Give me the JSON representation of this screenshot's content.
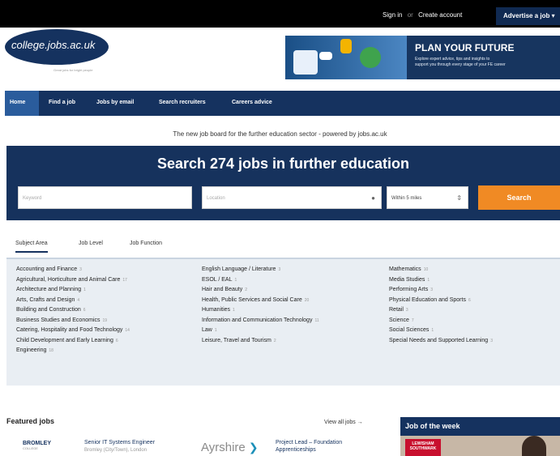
{
  "top": {
    "sign_in": "Sign in",
    "or": "or",
    "create_account": "Create account",
    "advertise": "Advertise a job"
  },
  "logo": {
    "text": "college.jobs.ac.uk",
    "tagline": "Great jobs for bright people"
  },
  "banner": {
    "title": "PLAN YOUR FUTURE",
    "sub1": "Explore expert advice, tips and insights to",
    "sub2": "support you through every stage of your FE career"
  },
  "nav": [
    "Home",
    "Find a job",
    "Jobs by email",
    "Search recruiters",
    "Careers advice"
  ],
  "tagline": "The new job board for the further education sector - powered by jobs.ac.uk",
  "search": {
    "title": "Search 274 jobs in further education",
    "keyword_placeholder": "Keyword",
    "location_placeholder": "Location",
    "distance": "Within 5 miles",
    "button": "Search"
  },
  "tabs": [
    "Subject Area",
    "Job Level",
    "Job Function"
  ],
  "categories": {
    "col1": [
      {
        "name": "Accounting and Finance",
        "count": "3"
      },
      {
        "name": "Agricultural, Horticulture and Animal Care",
        "count": "17"
      },
      {
        "name": "Architecture and Planning",
        "count": "1"
      },
      {
        "name": "Arts, Crafts and Design",
        "count": "4"
      },
      {
        "name": "Building and Construction",
        "count": "6"
      },
      {
        "name": "Business Studies and Economics",
        "count": "19"
      },
      {
        "name": "Catering, Hospitality and Food Technology",
        "count": "14"
      },
      {
        "name": "Child Development and Early Learning",
        "count": "6"
      },
      {
        "name": "Engineering",
        "count": "18"
      }
    ],
    "col2": [
      {
        "name": "English Language / Literature",
        "count": "3"
      },
      {
        "name": "ESOL / EAL",
        "count": "1"
      },
      {
        "name": "Hair and Beauty",
        "count": "2"
      },
      {
        "name": "Health, Public Services and Social Care",
        "count": "20"
      },
      {
        "name": "Humanities",
        "count": "1"
      },
      {
        "name": "Information and Communication Technology",
        "count": "11"
      },
      {
        "name": "Law",
        "count": "1"
      },
      {
        "name": "Leisure, Travel and Tourism",
        "count": "2"
      }
    ],
    "col3": [
      {
        "name": "Mathematics",
        "count": "10"
      },
      {
        "name": "Media Studies",
        "count": "1"
      },
      {
        "name": "Performing Arts",
        "count": "3"
      },
      {
        "name": "Physical Education and Sports",
        "count": "6"
      },
      {
        "name": "Retail",
        "count": "3"
      },
      {
        "name": "Science",
        "count": "7"
      },
      {
        "name": "Social Sciences",
        "count": "1"
      },
      {
        "name": "Special Needs and Supported Learning",
        "count": "3"
      }
    ]
  },
  "featured": {
    "title": "Featured jobs",
    "view_all": "View all jobs →",
    "job1": {
      "employer": "BROMLEY",
      "employer_sub": "COLLEGE",
      "title": "Senior IT Systems Engineer",
      "location": "Bromley (City/Town), London"
    },
    "job2": {
      "employer": "Ayrshire",
      "title1": "Project Lead – Foundation",
      "title2": "Apprenticeships"
    }
  },
  "job_of_week": {
    "title": "Job of the week",
    "logo1": "LEWISHAM",
    "logo2": "SOUTHWARK"
  }
}
